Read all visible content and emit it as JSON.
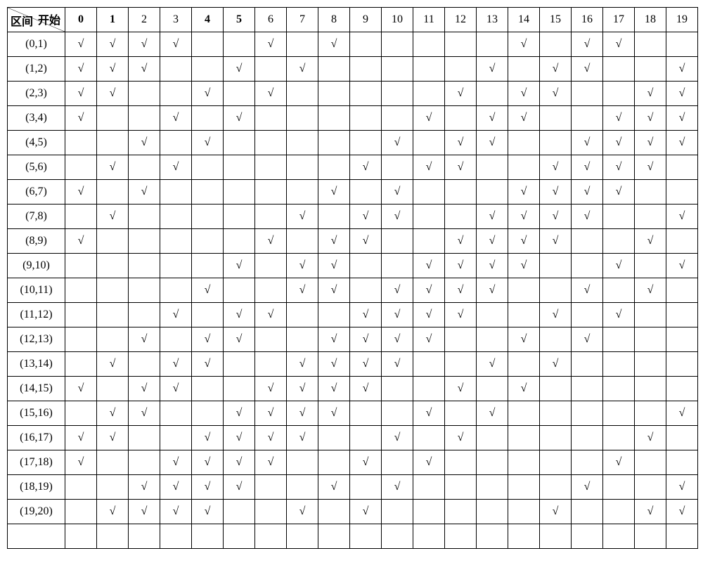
{
  "chart_data": {
    "type": "table",
    "title": "",
    "xlabel": "",
    "ylabel": "",
    "diag_header": {
      "top": "开始",
      "bottom": "区间"
    },
    "columns": [
      0,
      1,
      2,
      3,
      4,
      5,
      6,
      7,
      8,
      9,
      10,
      11,
      12,
      13,
      14,
      15,
      16,
      17,
      18,
      19
    ],
    "bold_columns": [
      0,
      1,
      4,
      5
    ],
    "rows": [
      {
        "label": "(0,1)",
        "checks": [
          0,
          1,
          2,
          3,
          6,
          8,
          14,
          16,
          17
        ]
      },
      {
        "label": "(1,2)",
        "checks": [
          0,
          1,
          2,
          5,
          7,
          13,
          15,
          16,
          19
        ]
      },
      {
        "label": "(2,3)",
        "checks": [
          0,
          1,
          4,
          6,
          12,
          14,
          15,
          18,
          19
        ]
      },
      {
        "label": "(3,4)",
        "checks": [
          0,
          3,
          5,
          11,
          13,
          14,
          17,
          18,
          19
        ]
      },
      {
        "label": "(4,5)",
        "checks": [
          2,
          4,
          10,
          12,
          13,
          16,
          17,
          18,
          19
        ]
      },
      {
        "label": "(5,6)",
        "checks": [
          1,
          3,
          9,
          11,
          12,
          15,
          16,
          17,
          18
        ]
      },
      {
        "label": "(6,7)",
        "checks": [
          0,
          2,
          8,
          10,
          14,
          15,
          16,
          17
        ]
      },
      {
        "label": "(7,8)",
        "checks": [
          1,
          7,
          9,
          10,
          13,
          14,
          15,
          16,
          19
        ]
      },
      {
        "label": "(8,9)",
        "checks": [
          0,
          6,
          8,
          9,
          12,
          13,
          14,
          15,
          18
        ]
      },
      {
        "label": "(9,10)",
        "checks": [
          5,
          7,
          8,
          11,
          12,
          13,
          14,
          17,
          19
        ]
      },
      {
        "label": "(10,11)",
        "checks": [
          4,
          7,
          8,
          10,
          11,
          12,
          13,
          16,
          18
        ]
      },
      {
        "label": "(11,12)",
        "checks": [
          3,
          5,
          6,
          9,
          10,
          11,
          12,
          15,
          17
        ]
      },
      {
        "label": "(12,13)",
        "checks": [
          2,
          4,
          5,
          8,
          9,
          10,
          11,
          14,
          16
        ]
      },
      {
        "label": "(13,14)",
        "checks": [
          1,
          3,
          4,
          7,
          8,
          9,
          10,
          13,
          15
        ]
      },
      {
        "label": "(14,15)",
        "checks": [
          0,
          2,
          3,
          6,
          7,
          8,
          9,
          12,
          14
        ]
      },
      {
        "label": "(15,16)",
        "checks": [
          1,
          2,
          5,
          6,
          7,
          8,
          11,
          13,
          19
        ]
      },
      {
        "label": "(16,17)",
        "checks": [
          0,
          1,
          4,
          5,
          6,
          7,
          10,
          12,
          18
        ]
      },
      {
        "label": "(17,18)",
        "checks": [
          0,
          3,
          4,
          5,
          6,
          9,
          11,
          17
        ]
      },
      {
        "label": "(18,19)",
        "checks": [
          2,
          3,
          4,
          5,
          8,
          10,
          16,
          19
        ]
      },
      {
        "label": "(19,20)",
        "checks": [
          1,
          2,
          3,
          4,
          7,
          9,
          15,
          18,
          19
        ]
      }
    ],
    "check_glyph": "√",
    "trailing_blank_rows": 1
  }
}
